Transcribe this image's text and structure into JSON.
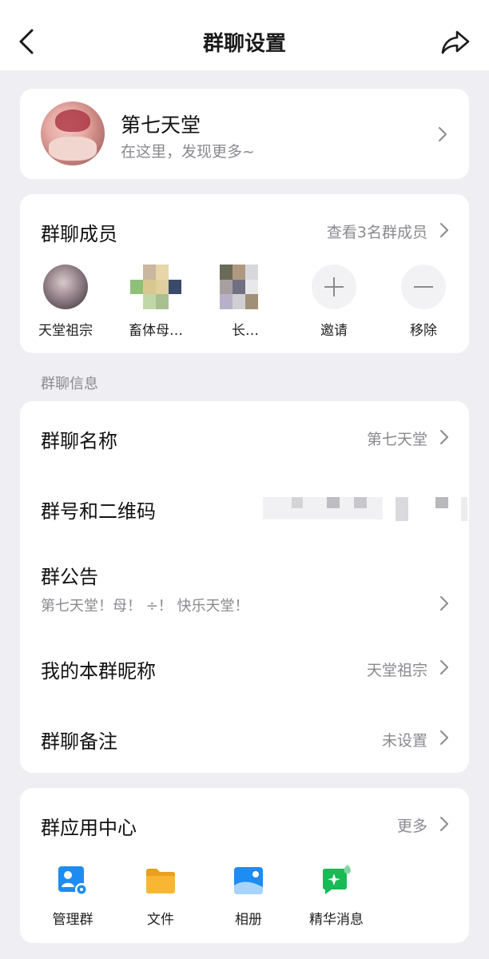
{
  "header": {
    "title": "群聊设置"
  },
  "profile": {
    "name": "第七天堂",
    "subtitle": "在这里，发现更多~"
  },
  "members": {
    "title": "群聊成员",
    "view_all": "查看3名群成员",
    "list": [
      {
        "label": "天堂祖宗"
      },
      {
        "label": "畜体母…"
      },
      {
        "label": "长…"
      }
    ],
    "invite_label": "邀请",
    "remove_label": "移除"
  },
  "info_section_label": "群聊信息",
  "info": {
    "group_name": {
      "title": "群聊名称",
      "value": "第七天堂"
    },
    "group_id_qr": {
      "title": "群号和二维码"
    },
    "announcement": {
      "title": "群公告",
      "content": "第七天堂！母！ ÷！ 快乐天堂！"
    },
    "my_nickname": {
      "title": "我的本群昵称",
      "value": "天堂祖宗"
    },
    "group_note": {
      "title": "群聊备注",
      "value": "未设置"
    }
  },
  "apps": {
    "title": "群应用中心",
    "more": "更多",
    "items": [
      {
        "label": "管理群",
        "icon": "manage-group-icon"
      },
      {
        "label": "文件",
        "icon": "folder-icon"
      },
      {
        "label": "相册",
        "icon": "album-icon"
      },
      {
        "label": "精华消息",
        "icon": "essence-message-icon"
      }
    ]
  },
  "colors": {
    "background": "#efeff3",
    "card": "#ffffff",
    "secondary_text": "#8a8a8f",
    "blue": "#1e8cf0",
    "yellow": "#f7b733",
    "green": "#19b955"
  }
}
